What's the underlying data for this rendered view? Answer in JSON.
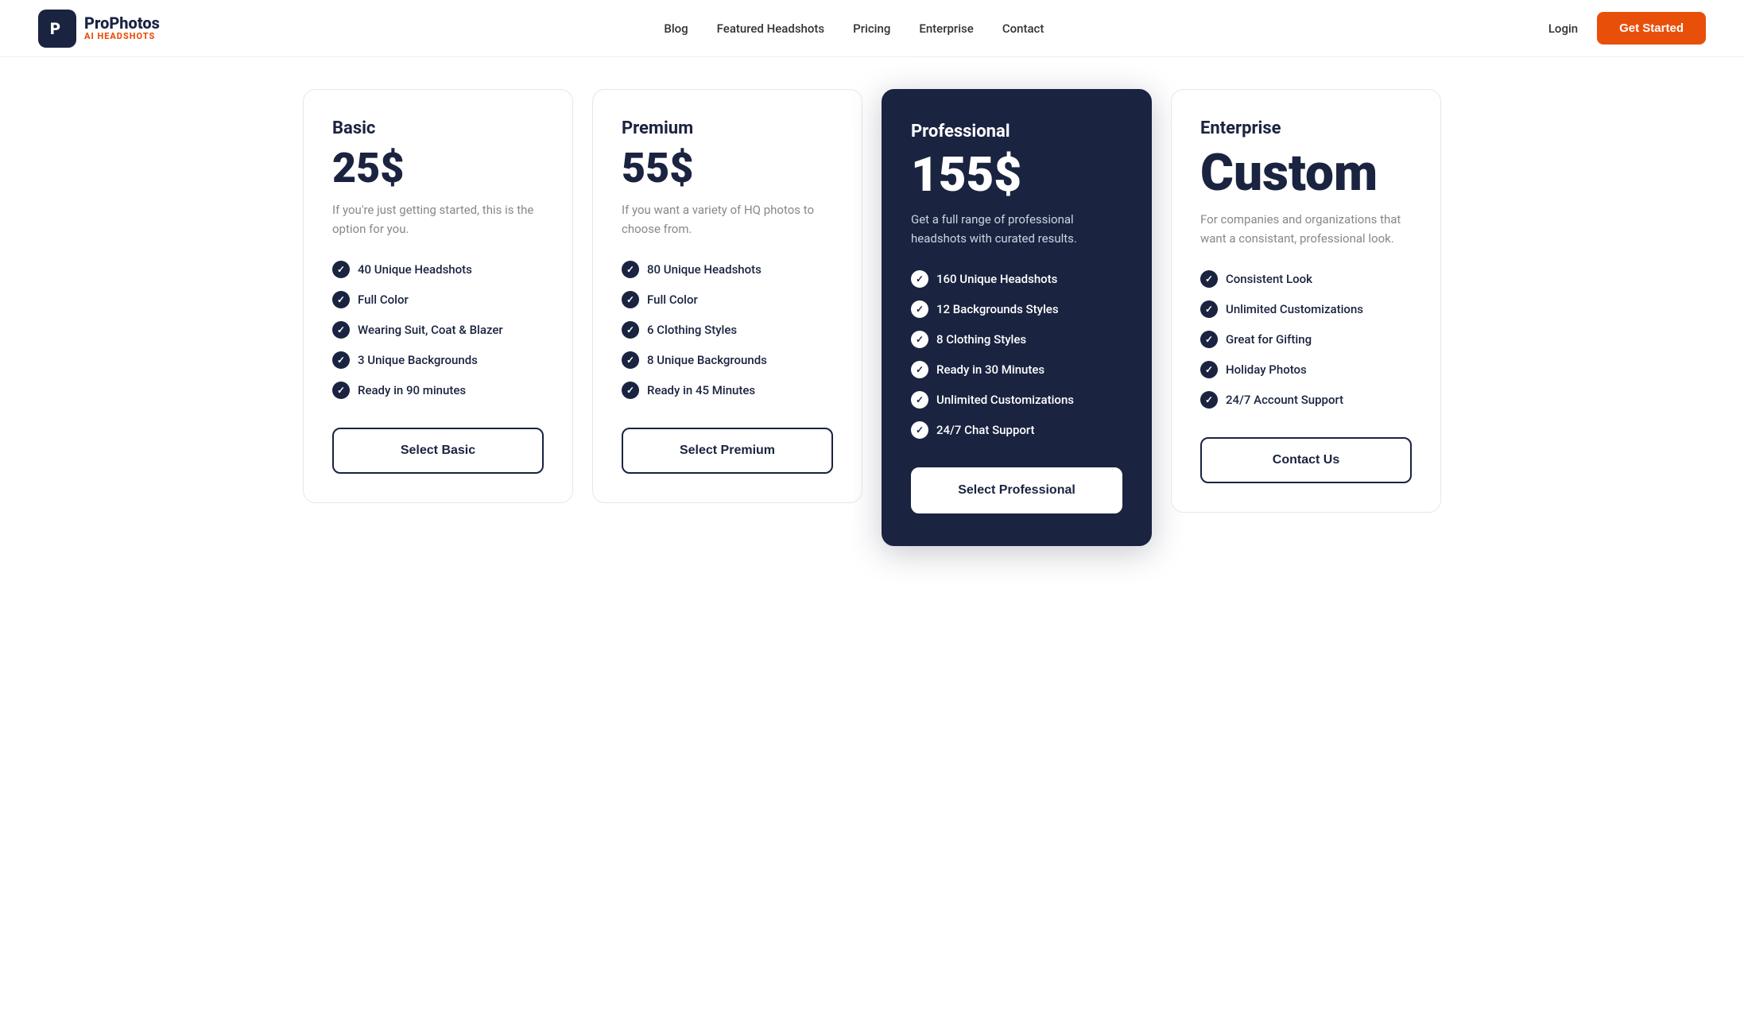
{
  "nav": {
    "logo_icon": "P",
    "logo_name": "ProPhotos",
    "logo_sub": "AI HEADSHOTS",
    "links": [
      "Blog",
      "Featured Headshots",
      "Pricing",
      "Enterprise",
      "Contact",
      "Login"
    ],
    "cta": "Get Started"
  },
  "plans": [
    {
      "id": "basic",
      "name": "Basic",
      "price": "25$",
      "desc": "If you're just getting started, this is the option for you.",
      "features": [
        "40 Unique Headshots",
        "Full Color",
        "Wearing Suit, Coat & Blazer",
        "3 Unique Backgrounds",
        "Ready in 90 minutes"
      ],
      "cta": "Select Basic",
      "featured": false
    },
    {
      "id": "premium",
      "name": "Premium",
      "price": "55$",
      "desc": "If you want a variety of HQ photos to choose from.",
      "features": [
        "80 Unique Headshots",
        "Full Color",
        "6 Clothing Styles",
        "8 Unique Backgrounds",
        "Ready in 45 Minutes"
      ],
      "cta": "Select Premium",
      "featured": false
    },
    {
      "id": "professional",
      "name": "Professional",
      "price": "155$",
      "desc": "Get a full range of professional headshots with curated results.",
      "features": [
        "160 Unique Headshots",
        "12 Backgrounds Styles",
        "8 Clothing Styles",
        "Ready in 30 Minutes",
        "Unlimited Customizations",
        "24/7 Chat Support"
      ],
      "cta": "Select Professional",
      "featured": true
    },
    {
      "id": "enterprise",
      "name": "Enterprise",
      "price": "Custom",
      "desc": "For companies and organizations that want a consistant, professional look.",
      "features": [
        "Consistent Look",
        "Unlimited Customizations",
        "Great for Gifting",
        "Holiday Photos",
        "24/7 Account Support"
      ],
      "cta": "Contact Us",
      "featured": false
    }
  ]
}
